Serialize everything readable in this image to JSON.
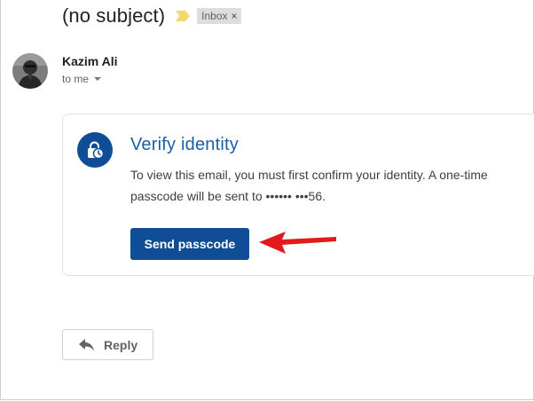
{
  "email": {
    "subject": "(no subject)",
    "label": "Inbox",
    "label_remove_glyph": "×",
    "sender": "Kazim Ali",
    "recipients": "to me"
  },
  "verify_card": {
    "title": "Verify identity",
    "body": "To view this email, you must first confirm your identity. A one-time passcode will be sent to •••••• •••56.",
    "button_label": "Send passcode",
    "icon": "lock-clock-icon"
  },
  "actions": {
    "reply_label": "Reply"
  },
  "colors": {
    "accent": "#0f4e96",
    "title": "#1a5fa8",
    "importance": "#f5d76e",
    "annotation_arrow": "#e3191e"
  }
}
